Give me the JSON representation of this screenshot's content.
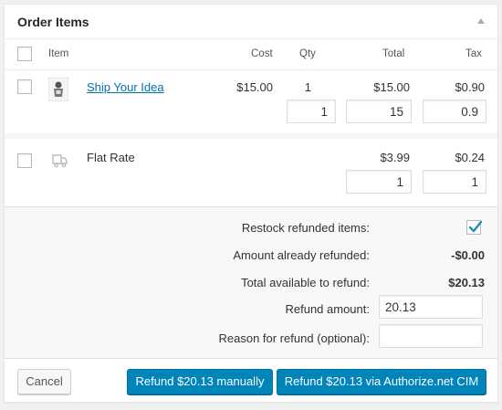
{
  "panel": {
    "title": "Order Items"
  },
  "columns": {
    "item": "Item",
    "cost": "Cost",
    "qty": "Qty",
    "total": "Total",
    "tax": "Tax"
  },
  "line_item": {
    "name": "Ship Your Idea",
    "cost": "$15.00",
    "qty": "1",
    "total": "$15.00",
    "tax": "$0.90",
    "refund_qty": "1",
    "refund_total": "15",
    "refund_tax": "0.9"
  },
  "shipping": {
    "name": "Flat Rate",
    "total": "$3.99",
    "tax": "$0.24",
    "refund_total": "1",
    "refund_tax": "1"
  },
  "refund": {
    "restock_label": "Restock refunded items:",
    "restock_checked": true,
    "already_label": "Amount already refunded:",
    "already_value": "-$0.00",
    "available_label": "Total available to refund:",
    "available_value": "$20.13",
    "amount_label": "Refund amount:",
    "amount_value": "20.13",
    "reason_label": "Reason for refund (optional):",
    "reason_value": ""
  },
  "buttons": {
    "cancel": "Cancel",
    "refund_manual": "Refund $20.13 manually",
    "refund_gateway": "Refund $20.13 via Authorize.net CIM"
  },
  "colors": {
    "accent": "#0085ba",
    "link": "#0073aa"
  },
  "icons": {
    "collapse": "triangle-up-icon",
    "shipping": "truck-icon",
    "check": "checkmark-icon"
  }
}
